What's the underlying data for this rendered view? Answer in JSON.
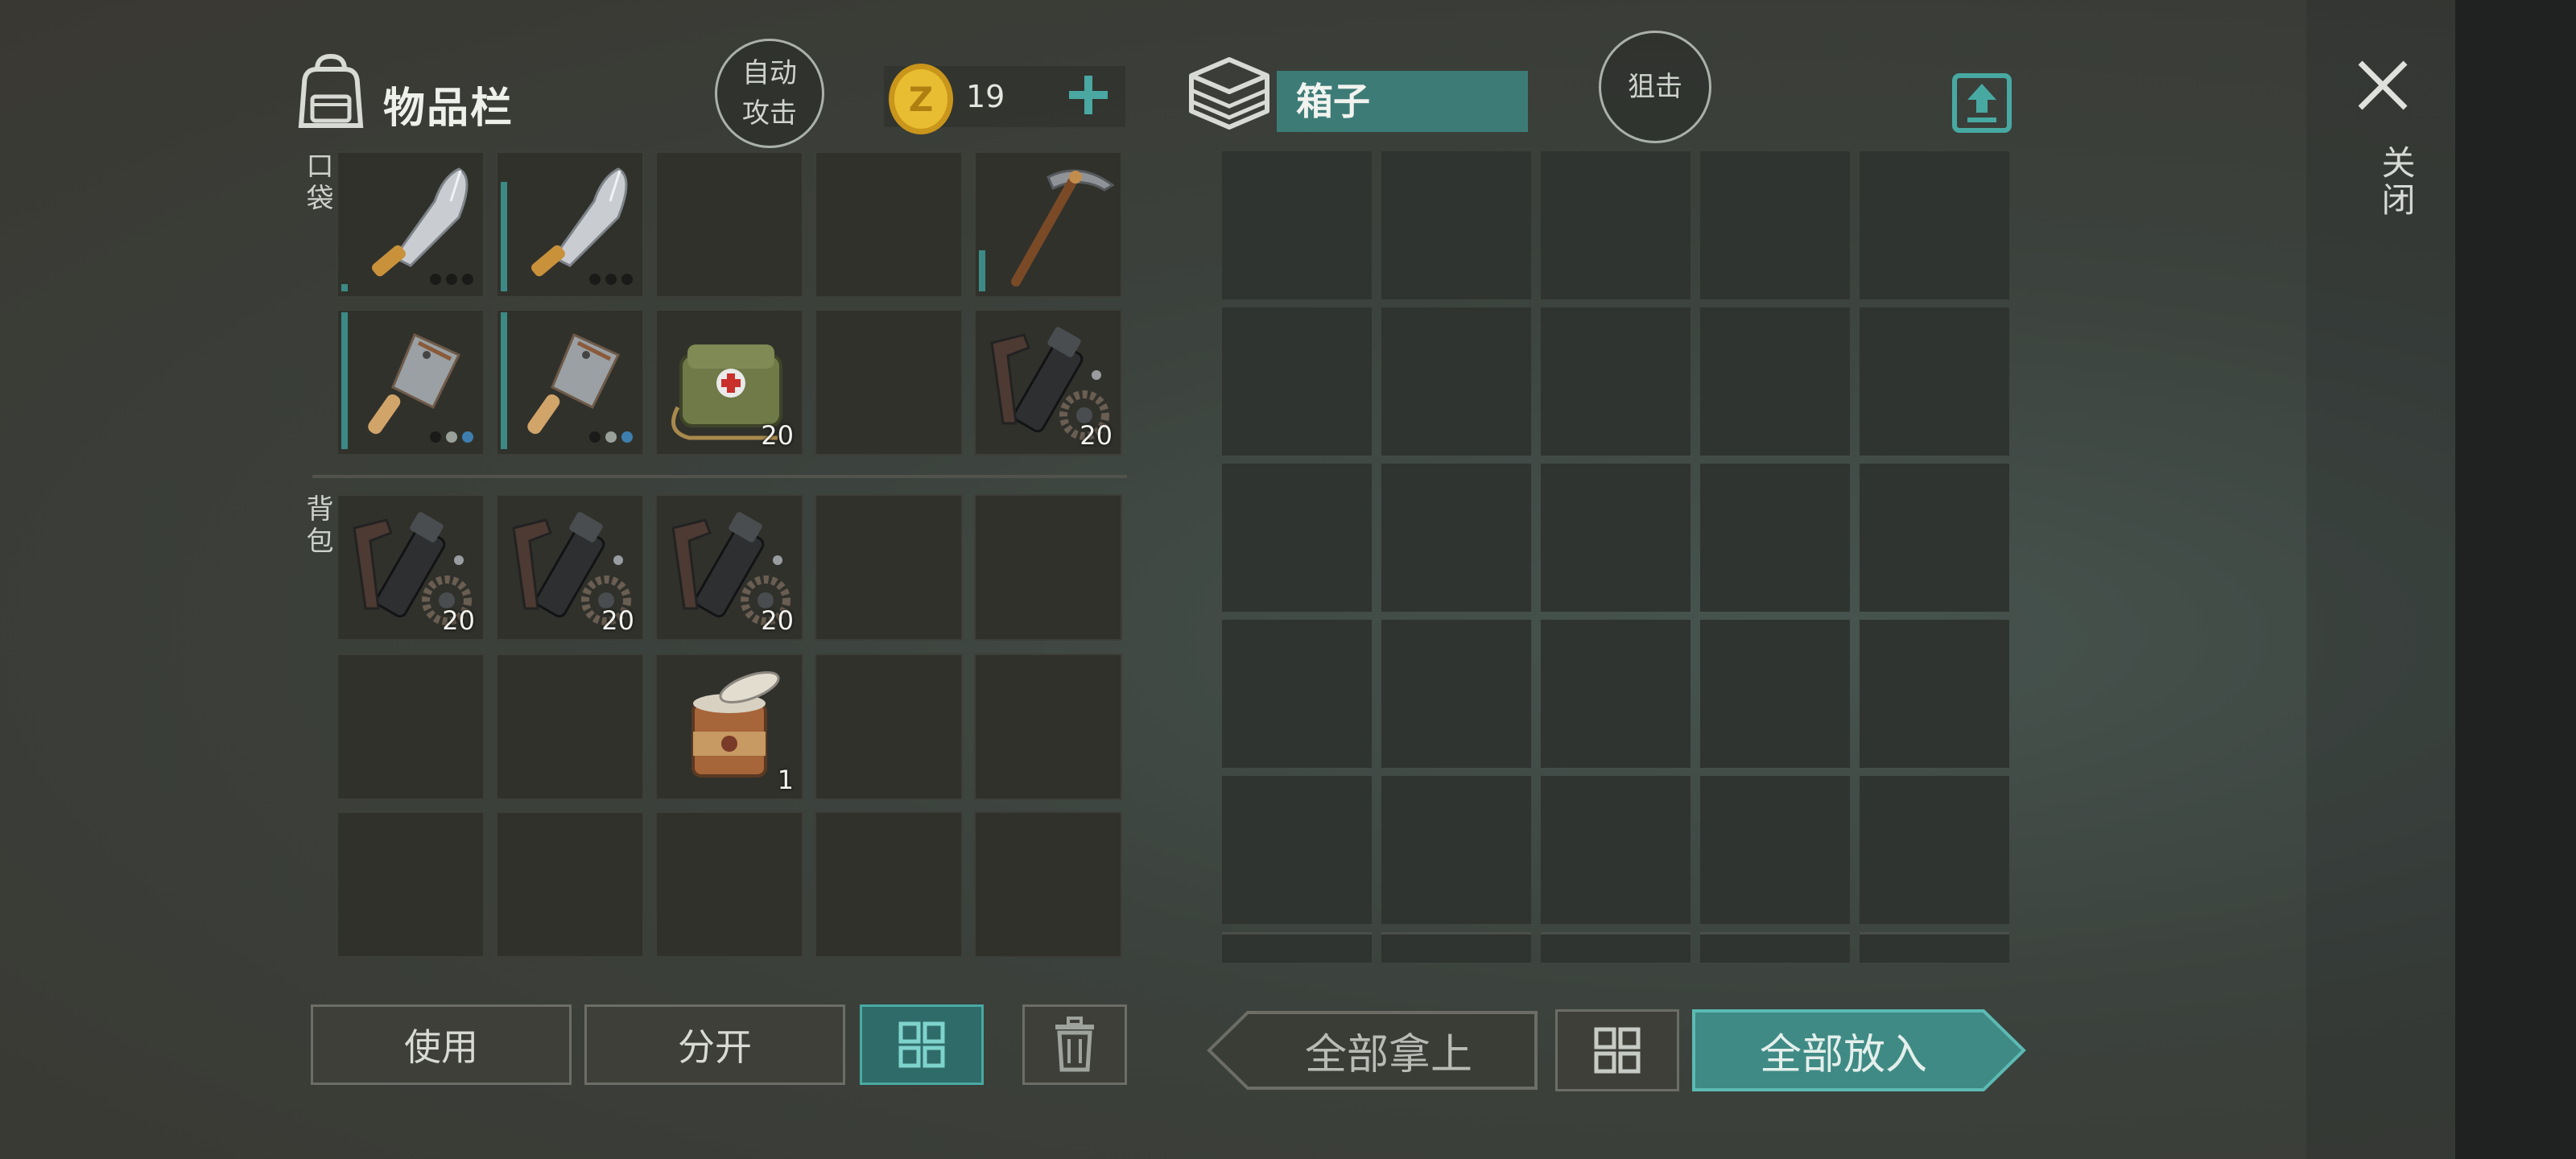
{
  "inventory": {
    "title": "物品栏",
    "auto_attack": [
      "自动",
      "攻击"
    ],
    "coins": "19",
    "pocket_label": "口袋",
    "backpack_label": "背包",
    "pocket_slots": [
      {
        "item": "machete",
        "dots": [
          "dark",
          "dark",
          "dark"
        ],
        "durability": 0.05
      },
      {
        "item": "machete",
        "dots": [
          "dark",
          "dark",
          "dark"
        ],
        "durability": 0.8
      },
      {
        "item": null
      },
      {
        "item": null
      },
      {
        "item": "pickaxe",
        "durability": 0.3
      },
      {
        "item": "cleaver",
        "dots": [
          "dark",
          "light",
          "blue"
        ],
        "durability": 1.0
      },
      {
        "item": "cleaver",
        "dots": [
          "dark",
          "light",
          "blue"
        ],
        "durability": 1.0
      },
      {
        "item": "medkit-bag",
        "qty": "20"
      },
      {
        "item": null
      },
      {
        "item": "repair-kit",
        "qty": "20"
      }
    ],
    "backpack_slots": [
      {
        "item": "repair-kit",
        "qty": "20"
      },
      {
        "item": "repair-kit",
        "qty": "20"
      },
      {
        "item": "repair-kit",
        "qty": "20"
      },
      {
        "item": null
      },
      {
        "item": null
      },
      {
        "item": null
      },
      {
        "item": null
      },
      {
        "item": "tin-can",
        "qty": "1"
      },
      {
        "item": null
      },
      {
        "item": null
      },
      {
        "item": null
      },
      {
        "item": null
      },
      {
        "item": null
      },
      {
        "item": null
      },
      {
        "item": null
      }
    ]
  },
  "box": {
    "name": "箱子",
    "snipe_label": "狙击"
  },
  "close": {
    "label": "关闭"
  },
  "actions": {
    "use": "使用",
    "split": "分开",
    "take_all": "全部拿上",
    "put_all": "全部放入"
  },
  "colors": {
    "accent": "#3d7b76",
    "coin": "#e0b52a",
    "slot": "#31312c"
  }
}
